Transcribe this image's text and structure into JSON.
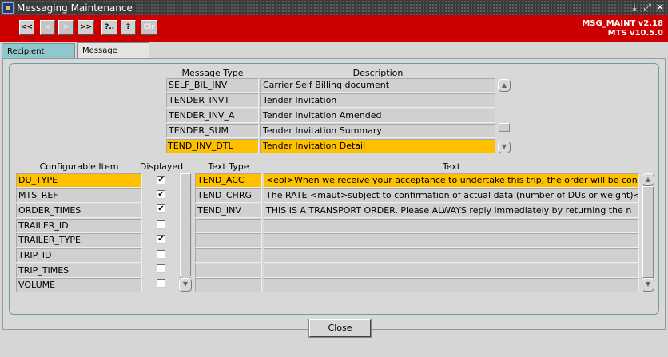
{
  "window": {
    "title": "Messaging Maintenance",
    "controls": [
      "⤓",
      "⤢",
      "✕"
    ]
  },
  "toolbar": {
    "buttons": [
      {
        "label": "<<",
        "enabled": true
      },
      {
        "label": "<",
        "enabled": false
      },
      {
        "label": ">",
        "enabled": false
      },
      {
        "label": ">>",
        "enabled": true
      },
      {
        "label": "?..",
        "enabled": true
      },
      {
        "label": "?",
        "enabled": true
      },
      {
        "label": "Clr",
        "enabled": false
      }
    ],
    "version_line1": "MSG_MAINT v2.18",
    "version_line2": "MTS v10.5.0"
  },
  "tabs": [
    {
      "label": "Recipient Config",
      "active": false
    },
    {
      "label": "Message Config",
      "active": true
    }
  ],
  "message_table": {
    "columns": [
      "Message Type",
      "Description"
    ],
    "rows": [
      {
        "type": "SELF_BIL_INV",
        "description": "Carrier Self Billing document",
        "selected": false
      },
      {
        "type": "TENDER_INVT",
        "description": "Tender Invitation",
        "selected": false
      },
      {
        "type": "TENDER_INV_A",
        "description": "Tender Invitation Amended",
        "selected": false
      },
      {
        "type": "TENDER_SUM",
        "description": "Tender Invitation Summary",
        "selected": false
      },
      {
        "type": "TEND_INV_DTL",
        "description": "Tender Invitation Detail",
        "selected": true
      }
    ]
  },
  "config_table": {
    "columns": [
      "Configurable Item",
      "Displayed"
    ],
    "rows": [
      {
        "item": "DU_TYPE",
        "displayed": true,
        "selected": true
      },
      {
        "item": "MTS_REF",
        "displayed": true,
        "selected": false
      },
      {
        "item": "ORDER_TIMES",
        "displayed": true,
        "selected": false
      },
      {
        "item": "TRAILER_ID",
        "displayed": false,
        "selected": false
      },
      {
        "item": "TRAILER_TYPE",
        "displayed": true,
        "selected": false
      },
      {
        "item": "TRIP_ID",
        "displayed": false,
        "selected": false
      },
      {
        "item": "TRIP_TIMES",
        "displayed": false,
        "selected": false
      },
      {
        "item": "VOLUME",
        "displayed": false,
        "selected": false
      }
    ]
  },
  "text_table": {
    "columns": [
      "Text Type",
      "Text"
    ],
    "rows": [
      {
        "type": "TEND_ACC",
        "text": "<eol>When we receive your acceptance to undertake this trip, the order will be consid",
        "selected": true
      },
      {
        "type": "TEND_CHRG",
        "text": "The RATE <maut>subject to confirmation of actual data (number of DUs or weight)<ec",
        "selected": false
      },
      {
        "type": "TEND_INV",
        "text": "THIS IS A TRANSPORT ORDER.  Please ALWAYS reply immediately by returning the n",
        "selected": false
      },
      {
        "type": "",
        "text": "",
        "selected": false
      },
      {
        "type": "",
        "text": "",
        "selected": false
      },
      {
        "type": "",
        "text": "",
        "selected": false
      },
      {
        "type": "",
        "text": "",
        "selected": false
      },
      {
        "type": "",
        "text": "",
        "selected": false
      }
    ]
  },
  "checkmark": "✔",
  "close_button": {
    "label": "Close"
  }
}
